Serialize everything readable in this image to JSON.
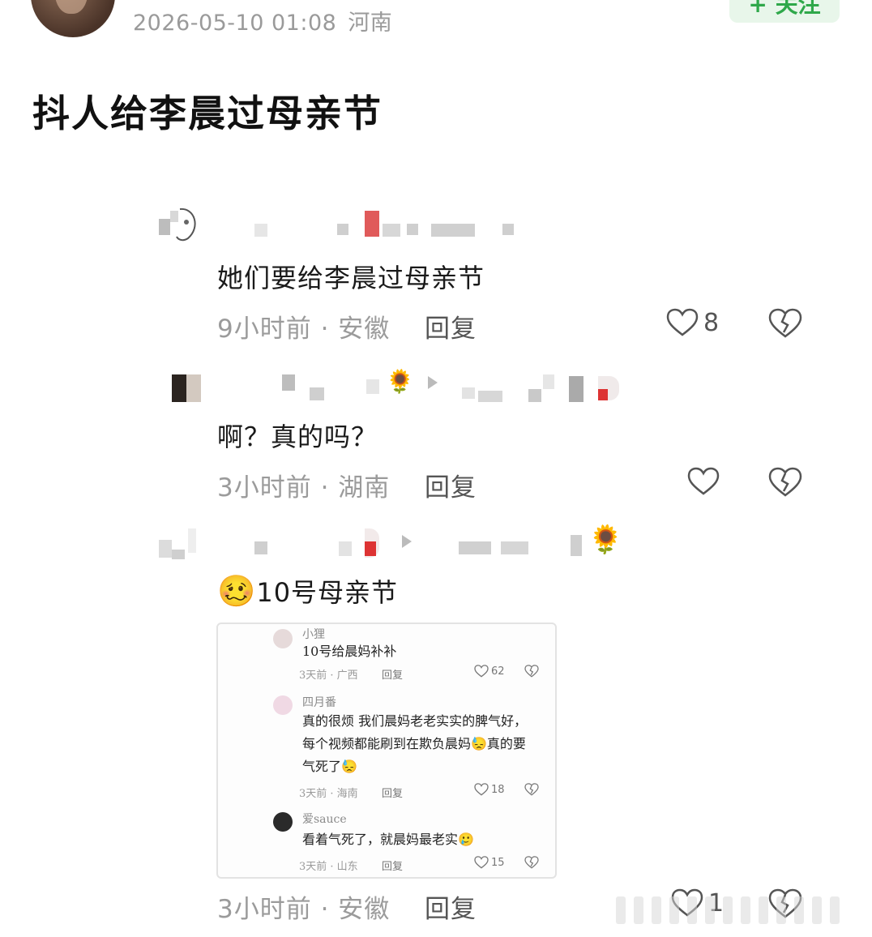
{
  "post": {
    "timestamp": "2026-05-10 01:08",
    "location": "河南",
    "follow_label": "+ 关注",
    "title": "抖人给李晨过母亲节"
  },
  "comments": [
    {
      "text": "她们要给李晨过母亲节",
      "meta": "9小时前 · 安徽",
      "reply": "回复",
      "likes": "8"
    },
    {
      "text": "啊？真的吗？",
      "meta": "3小时前 · 湖南",
      "reply": "回复",
      "likes": ""
    },
    {
      "text": "10号母亲节",
      "emoji": "🥴",
      "meta": "3小时前 · 安徽",
      "reply": "回复",
      "likes": "1"
    }
  ],
  "embedded": {
    "items": [
      {
        "name": "小狸",
        "text": "10号给晨妈补补",
        "meta": "3天前 · 广西",
        "reply": "回复",
        "likes": "62"
      },
      {
        "name": "四月番",
        "text": "真的很烦 我们晨妈老老实实的脾气好，每个视频都能刷到在欺负晨妈😓真的要气死了😓",
        "meta": "3天前 · 海南",
        "reply": "回复",
        "likes": "18"
      },
      {
        "name": "爱sauce",
        "text": "看着气死了，就晨妈最老实🥲",
        "meta": "3天前 · 山东",
        "reply": "回复",
        "likes": "15"
      }
    ]
  },
  "icons": {
    "like": "heart-outline-icon",
    "dislike": "broken-heart-icon",
    "sunflower": "sunflower-icon"
  },
  "colors": {
    "accent_green": "#2fa84a",
    "meta_gray": "#9b9b9b"
  }
}
